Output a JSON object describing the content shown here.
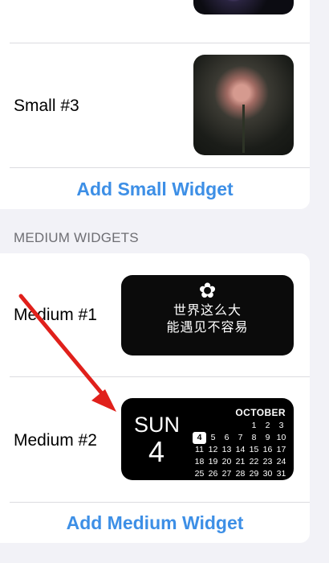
{
  "small_section": {
    "rows": [
      {
        "label": "Small #3"
      }
    ],
    "add_button": "Add Small Widget"
  },
  "medium_section": {
    "header": "MEDIUM WIDGETS",
    "rows": [
      {
        "label": "Medium #1"
      },
      {
        "label": "Medium #2"
      }
    ],
    "add_button": "Add Medium Widget"
  },
  "quote_widget": {
    "icon": "flower-icon",
    "line1": "世界这么大",
    "line2": "能遇见不容易"
  },
  "calendar_widget": {
    "day": "SUN",
    "date": "4",
    "month": "OCTOBER",
    "leading_blanks": 4,
    "days": [
      "1",
      "2",
      "3",
      "4",
      "5",
      "6",
      "7",
      "8",
      "9",
      "10",
      "11",
      "12",
      "13",
      "14",
      "15",
      "16",
      "17",
      "18",
      "19",
      "20",
      "21",
      "22",
      "23",
      "24",
      "25",
      "26",
      "27",
      "28",
      "29",
      "30",
      "31"
    ],
    "today": "4"
  },
  "annotation": {
    "icon": "red-arrow-icon",
    "color": "#e0201b"
  },
  "colors": {
    "accent": "#3d8fe6",
    "background": "#f2f2f7"
  }
}
